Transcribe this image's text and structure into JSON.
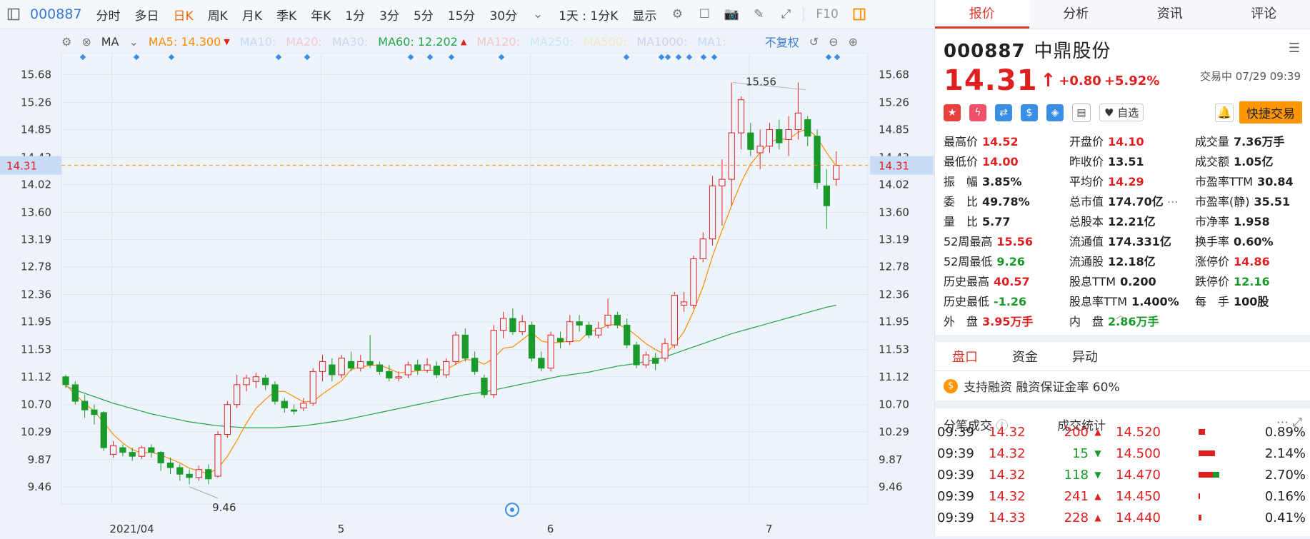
{
  "toolbar": {
    "code": "000887",
    "items": [
      "分时",
      "多日",
      "日K",
      "周K",
      "月K",
      "季K",
      "年K",
      "1分",
      "3分",
      "5分",
      "15分",
      "30分"
    ],
    "active": "日K",
    "period_select": "1天 : 1分K",
    "display_select": "显示",
    "f10": "F10"
  },
  "ma_bar": {
    "ma_label": "MA",
    "ma5": "MA5: 14.300",
    "ma10": "MA10:",
    "ma20": "MA20:",
    "ma30": "MA30:",
    "ma60": "MA60: 12.202",
    "ma120": "MA120:",
    "ma250": "MA250:",
    "ma500": "MA500:",
    "ma1000": "MA1000:",
    "ma1": "MA1:",
    "adjust": "不复权"
  },
  "chart_data": {
    "type": "candlestick",
    "y_ticks": [
      "15.68",
      "15.26",
      "14.85",
      "14.43",
      "14.02",
      "13.60",
      "13.19",
      "12.78",
      "12.36",
      "11.95",
      "11.53",
      "11.12",
      "10.70",
      "10.29",
      "9.87",
      "9.46"
    ],
    "x_labels": [
      "2021/04",
      "5",
      "6",
      "7"
    ],
    "current_price_label": "14.31",
    "high_annotation": "15.56",
    "low_annotation": "9.46",
    "ylim": [
      9.2,
      15.9
    ],
    "candles": [
      [
        11.12,
        11.0,
        11.15,
        10.95
      ],
      [
        11.0,
        10.75,
        11.05,
        10.7
      ],
      [
        10.75,
        10.62,
        10.85,
        10.5
      ],
      [
        10.62,
        10.55,
        10.7,
        10.4
      ],
      [
        10.58,
        10.05,
        10.6,
        10.0
      ],
      [
        9.95,
        10.08,
        10.15,
        9.9
      ],
      [
        10.05,
        9.98,
        10.1,
        9.92
      ],
      [
        9.98,
        9.92,
        10.05,
        9.85
      ],
      [
        9.92,
        10.05,
        10.08,
        9.88
      ],
      [
        10.05,
        9.98,
        10.1,
        9.9
      ],
      [
        9.98,
        9.82,
        10.0,
        9.7
      ],
      [
        9.82,
        9.75,
        9.9,
        9.65
      ],
      [
        9.75,
        9.65,
        9.8,
        9.55
      ],
      [
        9.65,
        9.6,
        9.72,
        9.5
      ],
      [
        9.6,
        9.72,
        9.78,
        9.55
      ],
      [
        9.72,
        9.58,
        9.8,
        9.5
      ],
      [
        9.62,
        10.25,
        10.3,
        9.6
      ],
      [
        10.25,
        10.7,
        10.75,
        10.2
      ],
      [
        10.7,
        11.0,
        11.15,
        10.65
      ],
      [
        11.0,
        11.1,
        11.15,
        10.9
      ],
      [
        11.05,
        11.12,
        11.18,
        10.95
      ],
      [
        11.1,
        11.0,
        11.15,
        10.92
      ],
      [
        11.0,
        10.75,
        11.05,
        10.7
      ],
      [
        10.75,
        10.65,
        10.8,
        10.58
      ],
      [
        10.62,
        10.6,
        10.7,
        10.55
      ],
      [
        10.65,
        10.72,
        10.8,
        10.6
      ],
      [
        10.72,
        11.2,
        11.25,
        10.68
      ],
      [
        11.2,
        11.35,
        11.45,
        11.05
      ],
      [
        11.3,
        11.15,
        11.4,
        11.05
      ],
      [
        11.15,
        11.4,
        11.45,
        11.1
      ],
      [
        11.35,
        11.25,
        11.5,
        11.2
      ],
      [
        11.25,
        11.35,
        11.45,
        11.2
      ],
      [
        11.35,
        11.3,
        11.75,
        11.25
      ],
      [
        11.3,
        11.2,
        11.35,
        11.15
      ],
      [
        11.2,
        11.1,
        11.3,
        11.05
      ],
      [
        11.1,
        11.12,
        11.2,
        11.05
      ],
      [
        11.15,
        11.3,
        11.35,
        11.1
      ],
      [
        11.3,
        11.22,
        11.38,
        11.15
      ],
      [
        11.22,
        11.3,
        11.4,
        11.18
      ],
      [
        11.28,
        11.15,
        11.35,
        11.1
      ],
      [
        11.15,
        11.35,
        11.4,
        11.1
      ],
      [
        11.35,
        11.75,
        11.8,
        11.3
      ],
      [
        11.75,
        11.4,
        11.85,
        11.35
      ],
      [
        11.4,
        11.2,
        11.5,
        11.15
      ],
      [
        11.1,
        10.85,
        11.15,
        10.8
      ],
      [
        10.85,
        11.82,
        11.9,
        10.8
      ],
      [
        11.82,
        12.0,
        12.1,
        11.7
      ],
      [
        12.0,
        11.8,
        12.15,
        11.75
      ],
      [
        11.8,
        11.95,
        12.05,
        11.75
      ],
      [
        11.9,
        11.4,
        11.95,
        11.35
      ],
      [
        11.4,
        11.25,
        11.5,
        11.2
      ],
      [
        11.25,
        11.75,
        11.8,
        11.2
      ],
      [
        11.7,
        11.65,
        11.8,
        11.55
      ],
      [
        11.65,
        11.95,
        12.05,
        11.6
      ],
      [
        11.95,
        11.9,
        12.05,
        11.8
      ],
      [
        11.9,
        11.75,
        11.95,
        11.7
      ],
      [
        11.75,
        11.85,
        11.95,
        11.7
      ],
      [
        11.9,
        12.05,
        12.3,
        11.85
      ],
      [
        12.05,
        11.9,
        12.1,
        11.85
      ],
      [
        11.9,
        11.6,
        12.0,
        11.55
      ],
      [
        11.6,
        11.3,
        11.65,
        11.25
      ],
      [
        11.3,
        11.45,
        11.5,
        11.25
      ],
      [
        11.4,
        11.32,
        11.48,
        11.22
      ],
      [
        11.4,
        11.62,
        11.7,
        11.35
      ],
      [
        11.6,
        12.35,
        12.4,
        11.55
      ],
      [
        12.2,
        12.25,
        12.4,
        12.1
      ],
      [
        12.2,
        12.9,
        12.95,
        12.15
      ],
      [
        12.9,
        13.2,
        13.3,
        12.85
      ],
      [
        13.2,
        14.0,
        14.15,
        13.1
      ],
      [
        14.0,
        14.1,
        14.4,
        13.4
      ],
      [
        14.1,
        14.8,
        15.56,
        13.7
      ],
      [
        14.8,
        15.3,
        15.35,
        14.55
      ],
      [
        14.8,
        14.55,
        14.95,
        14.45
      ],
      [
        14.5,
        14.6,
        14.85,
        14.25
      ],
      [
        14.6,
        14.85,
        14.95,
        14.5
      ],
      [
        14.85,
        14.65,
        15.0,
        14.55
      ],
      [
        14.7,
        14.85,
        15.05,
        14.45
      ],
      [
        14.85,
        15.1,
        15.56,
        14.7
      ],
      [
        15.0,
        14.75,
        15.05,
        14.6
      ],
      [
        14.75,
        14.05,
        14.85,
        13.95
      ],
      [
        14.0,
        13.7,
        14.25,
        13.35
      ],
      [
        14.1,
        14.31,
        14.52,
        14.0
      ]
    ],
    "ma5": [
      11.0,
      10.85,
      10.72,
      10.6,
      10.43,
      10.25,
      10.12,
      10.02,
      9.97,
      9.98,
      9.94,
      9.88,
      9.82,
      9.74,
      9.7,
      9.66,
      9.74,
      9.92,
      10.16,
      10.42,
      10.64,
      10.78,
      10.9,
      10.9,
      10.82,
      10.74,
      10.75,
      10.86,
      10.96,
      11.06,
      11.23,
      11.27,
      11.29,
      11.3,
      11.24,
      11.18,
      11.19,
      11.21,
      11.22,
      11.22,
      11.23,
      11.31,
      11.38,
      11.37,
      11.31,
      11.4,
      11.55,
      11.57,
      11.68,
      11.79,
      11.66,
      11.63,
      11.64,
      11.66,
      11.66,
      11.8,
      11.83,
      11.9,
      11.91,
      11.85,
      11.74,
      11.62,
      11.53,
      11.46,
      11.61,
      11.8,
      12.11,
      12.48,
      12.94,
      13.33,
      13.7,
      14.05,
      14.33,
      14.5,
      14.66,
      14.71,
      14.7,
      14.81,
      14.86,
      14.73,
      14.5,
      14.3
    ],
    "ma60": [
      10.98,
      10.92,
      10.87,
      10.82,
      10.77,
      10.72,
      10.68,
      10.64,
      10.6,
      10.56,
      10.53,
      10.5,
      10.47,
      10.44,
      10.42,
      10.4,
      10.38,
      10.37,
      10.36,
      10.35,
      10.35,
      10.35,
      10.35,
      10.36,
      10.37,
      10.38,
      10.4,
      10.42,
      10.44,
      10.46,
      10.49,
      10.52,
      10.55,
      10.58,
      10.61,
      10.64,
      10.67,
      10.7,
      10.73,
      10.76,
      10.79,
      10.82,
      10.85,
      10.87,
      10.89,
      10.92,
      10.95,
      10.98,
      11.01,
      11.04,
      11.07,
      11.1,
      11.13,
      11.15,
      11.17,
      11.19,
      11.22,
      11.25,
      11.28,
      11.3,
      11.32,
      11.35,
      11.38,
      11.42,
      11.47,
      11.52,
      11.57,
      11.62,
      11.67,
      11.72,
      11.77,
      11.81,
      11.85,
      11.89,
      11.93,
      11.97,
      12.01,
      12.05,
      12.09,
      12.13,
      12.17,
      12.2
    ]
  },
  "panel": {
    "tabs": [
      "报价",
      "分析",
      "资讯",
      "评论"
    ],
    "active_tab": "报价",
    "code": "000887",
    "name": "中鼎股份",
    "price": "14.31",
    "change": "+0.80",
    "change_pct": "+5.92%",
    "status": "交易中 07/29 09:39",
    "zixuan": "自选",
    "quick_trade": "快捷交易",
    "stats": [
      [
        "最高价",
        "14.52",
        "red"
      ],
      [
        "开盘价",
        "14.10",
        "red"
      ],
      [
        "成交量",
        "7.36万手",
        "blk"
      ],
      [
        "最低价",
        "14.00",
        "red"
      ],
      [
        "昨收价",
        "13.51",
        "blk"
      ],
      [
        "成交额",
        "1.05亿",
        "blk"
      ],
      [
        "振　幅",
        "3.85%",
        "blk"
      ],
      [
        "平均价",
        "14.29",
        "red"
      ],
      [
        "市盈率TTM",
        "30.84",
        "blk"
      ],
      [
        "委　比",
        "49.78%",
        "blk"
      ],
      [
        "总市值",
        "174.70亿",
        "blk"
      ],
      [
        "市盈率(静)",
        "35.51",
        "blk"
      ],
      [
        "量　比",
        "5.77",
        "blk"
      ],
      [
        "总股本",
        "12.21亿",
        "blk"
      ],
      [
        "市净率",
        "1.958",
        "blk"
      ],
      [
        "52周最高",
        "15.56",
        "red"
      ],
      [
        "流通值",
        "174.331亿",
        "blk"
      ],
      [
        "换手率",
        "0.60%",
        "blk"
      ],
      [
        "52周最低",
        "9.26",
        "green"
      ],
      [
        "流通股",
        "12.18亿",
        "blk"
      ],
      [
        "涨停价",
        "14.86",
        "red"
      ],
      [
        "历史最高",
        "40.57",
        "red"
      ],
      [
        "股息TTM",
        "0.200",
        "blk"
      ],
      [
        "跌停价",
        "12.16",
        "green"
      ],
      [
        "历史最低",
        "-1.26",
        "green"
      ],
      [
        "股息率TTM",
        "1.400%",
        "blk"
      ],
      [
        "每　手",
        "100股",
        "blk"
      ],
      [
        "外　盘",
        "3.95万手",
        "red"
      ],
      [
        "内　盘",
        "2.86万手",
        "green"
      ],
      [
        "",
        "",
        " "
      ]
    ],
    "subtabs": [
      "盘口",
      "资金",
      "异动"
    ],
    "rongzi": "支持融资 融资保证金率 60%",
    "fenbi_title": "分笔成交",
    "stat_title": "成交统计",
    "trades": [
      {
        "time": "09:39",
        "price": "14.32",
        "vol": "200",
        "dir": "up",
        "sp": "14.520",
        "pct": "0.89%",
        "bar": 0.1,
        "g": 0
      },
      {
        "time": "09:39",
        "price": "14.32",
        "vol": "15",
        "dir": "down",
        "sp": "14.500",
        "pct": "2.14%",
        "bar": 0.25,
        "g": 0
      },
      {
        "time": "09:39",
        "price": "14.32",
        "vol": "118",
        "dir": "down",
        "sp": "14.470",
        "pct": "2.70%",
        "bar": 0.22,
        "g": 0.1
      },
      {
        "time": "09:39",
        "price": "14.32",
        "vol": "241",
        "dir": "up",
        "sp": "14.450",
        "pct": "0.16%",
        "bar": 0.02,
        "g": 0
      },
      {
        "time": "09:39",
        "price": "14.33",
        "vol": "228",
        "dir": "up",
        "sp": "14.440",
        "pct": "0.41%",
        "bar": 0.04,
        "g": 0
      }
    ]
  }
}
